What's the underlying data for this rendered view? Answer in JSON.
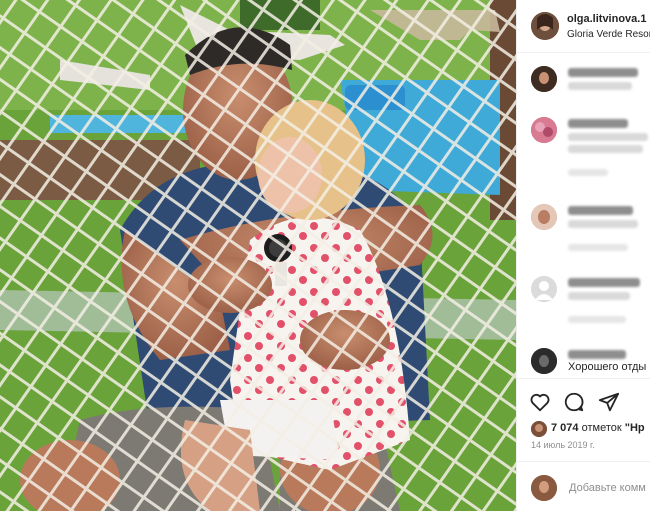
{
  "post": {
    "username": "olga.litvinova.1",
    "location": "Gloria Verde Resor"
  },
  "comments": [
    {
      "visible_text": ""
    },
    {
      "visible_text": ""
    },
    {
      "visible_text": ""
    },
    {
      "visible_text": ""
    },
    {
      "visible_text": ""
    },
    {
      "visible_text": "Хорошего отды"
    }
  ],
  "actions": {
    "like_icon": "heart-icon",
    "comment_icon": "comment-icon",
    "share_icon": "paper-plane-icon",
    "likes_count": "7 074",
    "likes_word": "отметок",
    "likes_suffix": "\"Нр",
    "date": "14 июль 2019 г.",
    "add_comment_placeholder": "Добавьте комм"
  },
  "colors": {
    "text": "#262626",
    "muted": "#8e8e8e",
    "border": "#efefef",
    "pool": "#3fa9d8",
    "grass": "#6aa33a"
  }
}
